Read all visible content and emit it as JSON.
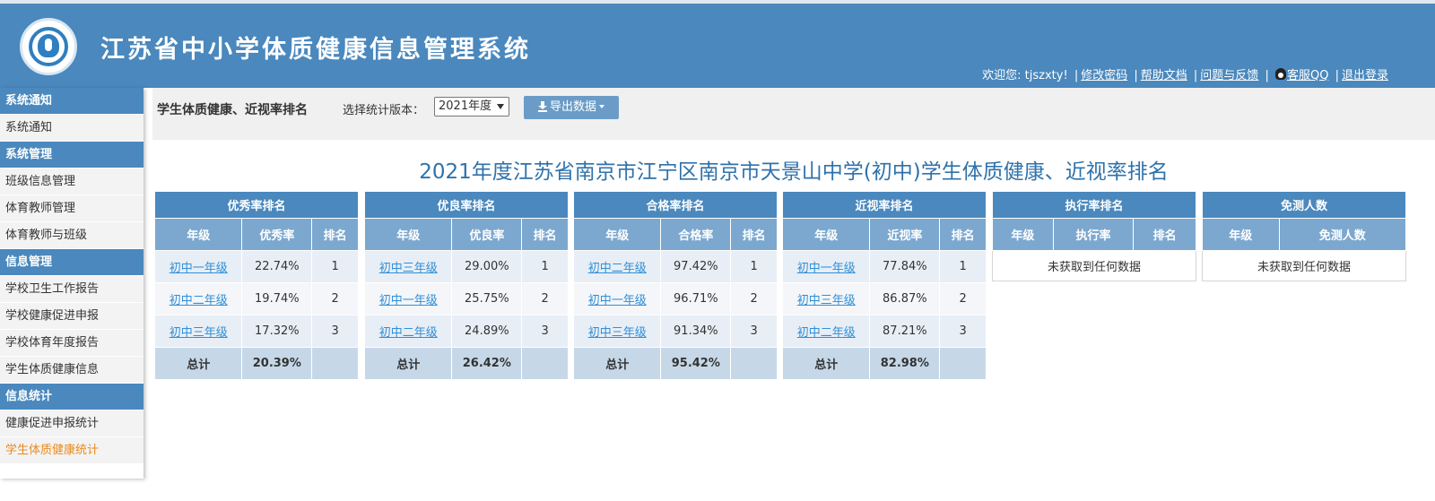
{
  "header": {
    "title": "江苏省中小学体质健康信息管理系统",
    "welcome": "欢迎您: tjszxty!",
    "links": {
      "change_password": "修改密码",
      "help": "帮助文档",
      "feedback": "问题与反馈",
      "qq": "客服QQ",
      "logout": "退出登录"
    }
  },
  "sidebar": [
    {
      "type": "section",
      "label": "系统通知"
    },
    {
      "type": "item",
      "label": "系统通知"
    },
    {
      "type": "section",
      "label": "系统管理"
    },
    {
      "type": "item",
      "label": "班级信息管理"
    },
    {
      "type": "item",
      "label": "体育教师管理"
    },
    {
      "type": "item",
      "label": "体育教师与班级"
    },
    {
      "type": "section",
      "label": "信息管理"
    },
    {
      "type": "item",
      "label": "学校卫生工作报告"
    },
    {
      "type": "item",
      "label": "学校健康促进申报"
    },
    {
      "type": "item",
      "label": "学校体育年度报告"
    },
    {
      "type": "item",
      "label": "学生体质健康信息"
    },
    {
      "type": "section",
      "label": "信息统计"
    },
    {
      "type": "item",
      "label": "健康促进申报统计"
    },
    {
      "type": "item",
      "label": "学生体质健康统计",
      "active": true
    }
  ],
  "toolbar": {
    "title": "学生体质健康、近视率排名",
    "version_label": "选择统计版本：",
    "version_value": "2021年度",
    "export_label": "导出数据"
  },
  "page_heading": "2021年度江苏省南京市江宁区南京市天景山中学(初中)学生体质健康、近视率排名",
  "tables": [
    {
      "caption": "优秀率排名",
      "columns": [
        "年级",
        "优秀率",
        "排名"
      ],
      "rows": [
        [
          "初中一年级",
          "22.74%",
          "1"
        ],
        [
          "初中二年级",
          "19.74%",
          "2"
        ],
        [
          "初中三年级",
          "17.32%",
          "3"
        ]
      ],
      "total_label": "总计",
      "total_value": "20.39%"
    },
    {
      "caption": "优良率排名",
      "columns": [
        "年级",
        "优良率",
        "排名"
      ],
      "rows": [
        [
          "初中三年级",
          "29.00%",
          "1"
        ],
        [
          "初中一年级",
          "25.75%",
          "2"
        ],
        [
          "初中二年级",
          "24.89%",
          "3"
        ]
      ],
      "total_label": "总计",
      "total_value": "26.42%"
    },
    {
      "caption": "合格率排名",
      "columns": [
        "年级",
        "合格率",
        "排名"
      ],
      "rows": [
        [
          "初中二年级",
          "97.42%",
          "1"
        ],
        [
          "初中一年级",
          "96.71%",
          "2"
        ],
        [
          "初中三年级",
          "91.34%",
          "3"
        ]
      ],
      "total_label": "总计",
      "total_value": "95.42%"
    },
    {
      "caption": "近视率排名",
      "columns": [
        "年级",
        "近视率",
        "排名"
      ],
      "rows": [
        [
          "初中一年级",
          "77.84%",
          "1"
        ],
        [
          "初中三年级",
          "86.87%",
          "2"
        ],
        [
          "初中二年级",
          "87.21%",
          "3"
        ]
      ],
      "total_label": "总计",
      "total_value": "82.98%"
    },
    {
      "caption": "执行率排名",
      "columns": [
        "年级",
        "执行率",
        "排名"
      ],
      "empty_text": "未获取到任何数据"
    },
    {
      "caption": "免测人数",
      "columns": [
        "年级",
        "免测人数"
      ],
      "empty_text": "未获取到任何数据"
    }
  ]
}
